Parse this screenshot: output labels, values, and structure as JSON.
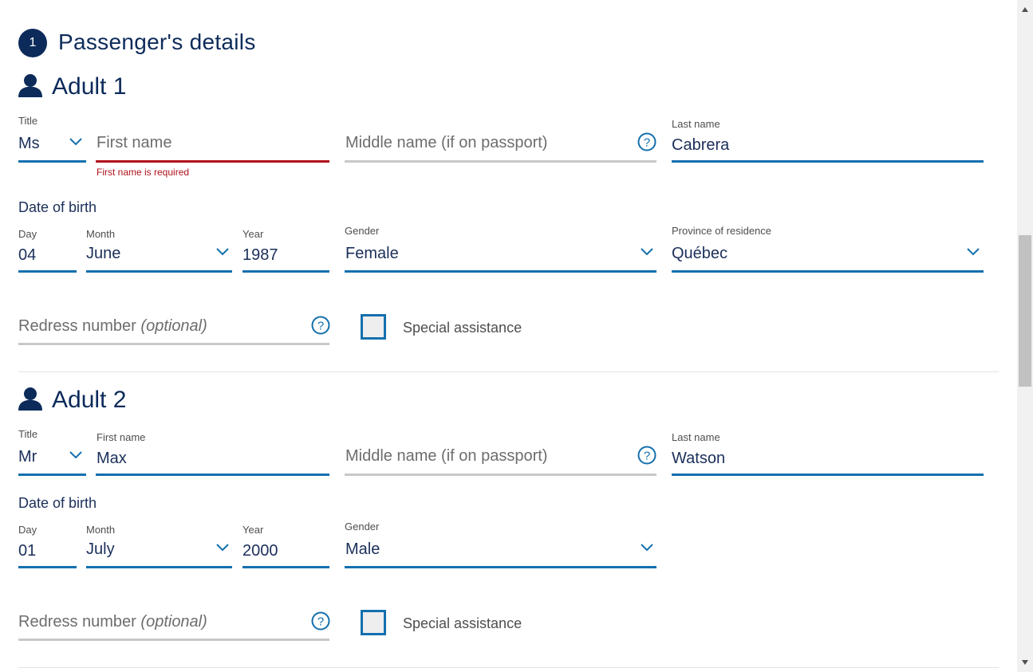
{
  "section": {
    "number": "1",
    "title": "Passenger's details"
  },
  "adults": [
    {
      "title_heading": "Adult 1",
      "title_label": "Title",
      "title_value": "Ms",
      "first_name_label": "",
      "first_name_placeholder": "First name",
      "first_name_value": "",
      "first_name_error": "First name is required",
      "middle_name_placeholder": "Middle name (if on passport)",
      "last_name_label": "Last name",
      "last_name_value": "Cabrera",
      "dob_label": "Date of birth",
      "day_label": "Day",
      "day_value": "04",
      "month_label": "Month",
      "month_value": "June",
      "year_label": "Year",
      "year_value": "1987",
      "gender_label": "Gender",
      "gender_value": "Female",
      "province_label": "Province of residence",
      "province_value": "Québec",
      "redress_placeholder": "Redress number",
      "redress_optional": "(optional)",
      "special_assistance_label": "Special assistance",
      "special_assistance_checked": false
    },
    {
      "title_heading": "Adult 2",
      "title_label": "Title",
      "title_value": "Mr",
      "first_name_label": "First name",
      "first_name_value": "Max",
      "middle_name_placeholder": "Middle name (if on passport)",
      "last_name_label": "Last name",
      "last_name_value": "Watson",
      "dob_label": "Date of birth",
      "day_label": "Day",
      "day_value": "01",
      "month_label": "Month",
      "month_value": "July",
      "year_label": "Year",
      "year_value": "2000",
      "gender_label": "Gender",
      "gender_value": "Male",
      "redress_placeholder": "Redress number",
      "redress_optional": "(optional)",
      "special_assistance_label": "Special assistance",
      "special_assistance_checked": false
    }
  ],
  "icons": {
    "person": "person-icon",
    "help": "help-icon",
    "chevron": "chevron-down-icon"
  },
  "colors": {
    "navy": "#0c2b5a",
    "field_underline": "#1470ae",
    "error": "#b0121b",
    "inactive_underline": "#c8c8c8"
  }
}
